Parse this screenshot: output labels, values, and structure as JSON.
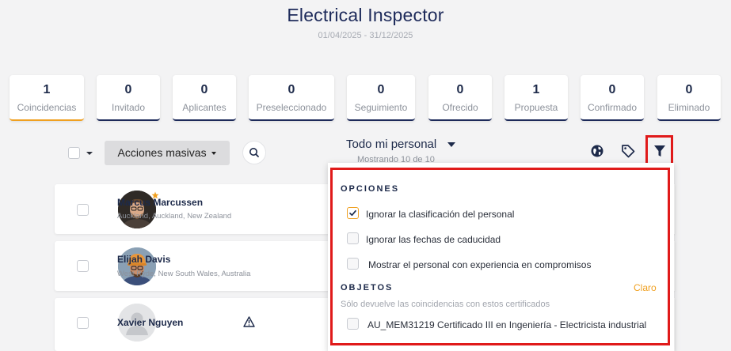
{
  "header": {
    "title": "Electrical Inspector",
    "dates": "01/04/2025 - 31/12/2025"
  },
  "stats": [
    {
      "count": "1",
      "label": "Coincidencias"
    },
    {
      "count": "0",
      "label": "Invitado"
    },
    {
      "count": "0",
      "label": "Aplicantes"
    },
    {
      "count": "0",
      "label": "Preseleccionado"
    },
    {
      "count": "0",
      "label": "Seguimiento"
    },
    {
      "count": "0",
      "label": "Ofrecido"
    },
    {
      "count": "1",
      "label": "Propuesta"
    },
    {
      "count": "0",
      "label": "Confirmado"
    },
    {
      "count": "0",
      "label": "Eliminado"
    }
  ],
  "toolbar": {
    "bulk_actions_label": "Acciones masivas",
    "staff_filter": "Todo mi personal",
    "showing": "Mostrando 10 de 10"
  },
  "candidates": [
    {
      "name": "Marcus Marcussen",
      "location": "Auckland, Auckland, New Zealand"
    },
    {
      "name": "Elijah Davis",
      "location": "West Ryde, New South Wales, Australia"
    },
    {
      "name": "Xavier Nguyen",
      "location": ""
    }
  ],
  "filter_panel": {
    "options_heading": "OPCIONES",
    "options": [
      {
        "label": "Ignorar la clasificación del personal",
        "checked": true
      },
      {
        "label": "Ignorar las fechas de caducidad",
        "checked": false
      },
      {
        "label": "Mostrar el personal con experiencia en compromisos",
        "checked": false
      }
    ],
    "objects_heading": "OBJETOS",
    "clear_label": "Claro",
    "objects_hint": "Sólo devuelve las coincidencias con estos certificados",
    "certificates": [
      {
        "label": "AU_MEM31219 Certificado III en Ingeniería - Electricista industrial",
        "checked": false
      }
    ]
  },
  "colors": {
    "accent": "#f0a020",
    "navy": "#1d2a5a",
    "highlight": "#e01a1a"
  }
}
